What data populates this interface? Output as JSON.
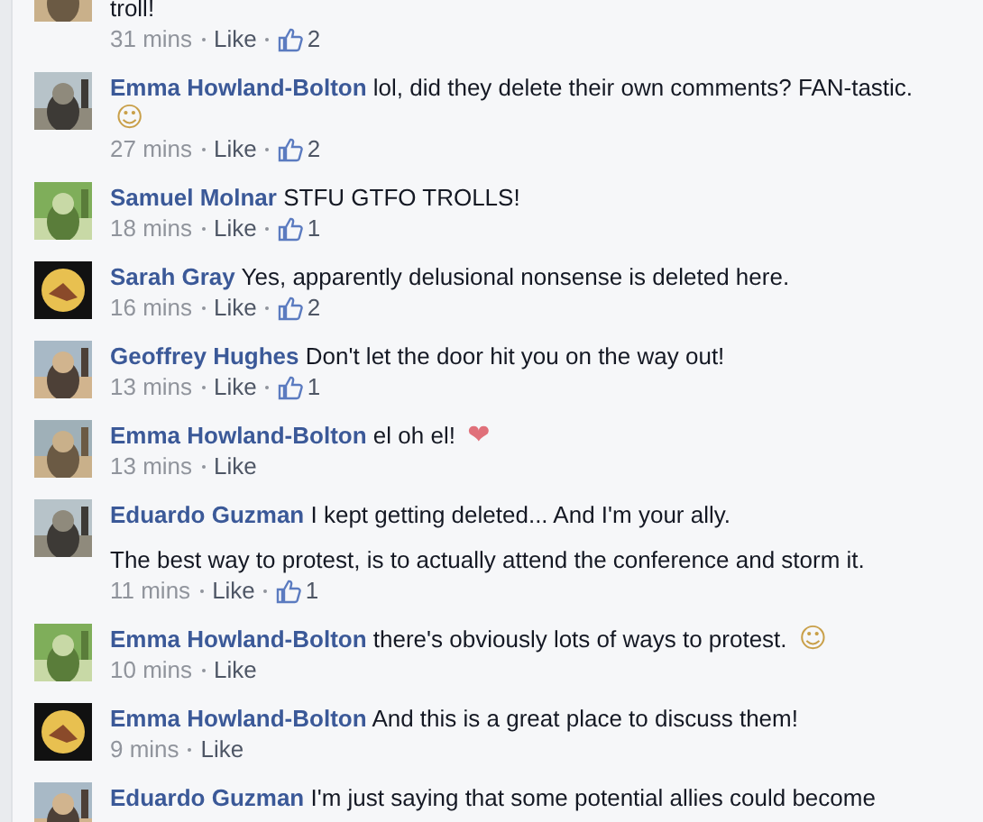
{
  "comments": [
    {
      "paragraphs": [
        "troll!"
      ],
      "time": "31 mins",
      "like": "Like",
      "likes": "2"
    },
    {
      "author": "Emma Howland-Bolton",
      "paragraphs": [
        "lol, did they delete their own comments? FAN-tastic."
      ],
      "emoji": {
        "text": "☺",
        "color": "#c9a04a"
      },
      "time": "27 mins",
      "like": "Like",
      "likes": "2"
    },
    {
      "author": "Samuel Molnar",
      "paragraphs": [
        "STFU GTFO TROLLS!"
      ],
      "time": "18 mins",
      "like": "Like",
      "likes": "1"
    },
    {
      "author": "Sarah Gray",
      "paragraphs": [
        "Yes, apparently delusional nonsense is deleted here."
      ],
      "time": "16 mins",
      "like": "Like",
      "likes": "2"
    },
    {
      "author": "Geoffrey Hughes",
      "paragraphs": [
        "Don't let the door hit you on the way out!"
      ],
      "time": "13 mins",
      "like": "Like",
      "likes": "1"
    },
    {
      "author": "Emma Howland-Bolton",
      "paragraphs": [
        "el oh el!"
      ],
      "emoji": {
        "text": "❤",
        "color": "#e0707a"
      },
      "time": "13 mins",
      "like": "Like"
    },
    {
      "author": "Eduardo Guzman",
      "paragraphs": [
        "I kept getting deleted... And I'm your ally.",
        "The best way to protest, is to actually attend the conference and storm it."
      ],
      "time": "11 mins",
      "like": "Like",
      "likes": "1"
    },
    {
      "author": "Emma Howland-Bolton",
      "paragraphs": [
        "there's obviously lots of ways to protest."
      ],
      "emoji": {
        "text": "☺",
        "color": "#c9a04a"
      },
      "time": "10 mins",
      "like": "Like"
    },
    {
      "author": "Emma Howland-Bolton",
      "paragraphs": [
        "And this is a great place to discuss them!"
      ],
      "time": "9 mins",
      "like": "Like"
    },
    {
      "author": "Eduardo Guzman",
      "paragraphs": [
        "I'm just saying that some potential allies could become"
      ]
    }
  ]
}
